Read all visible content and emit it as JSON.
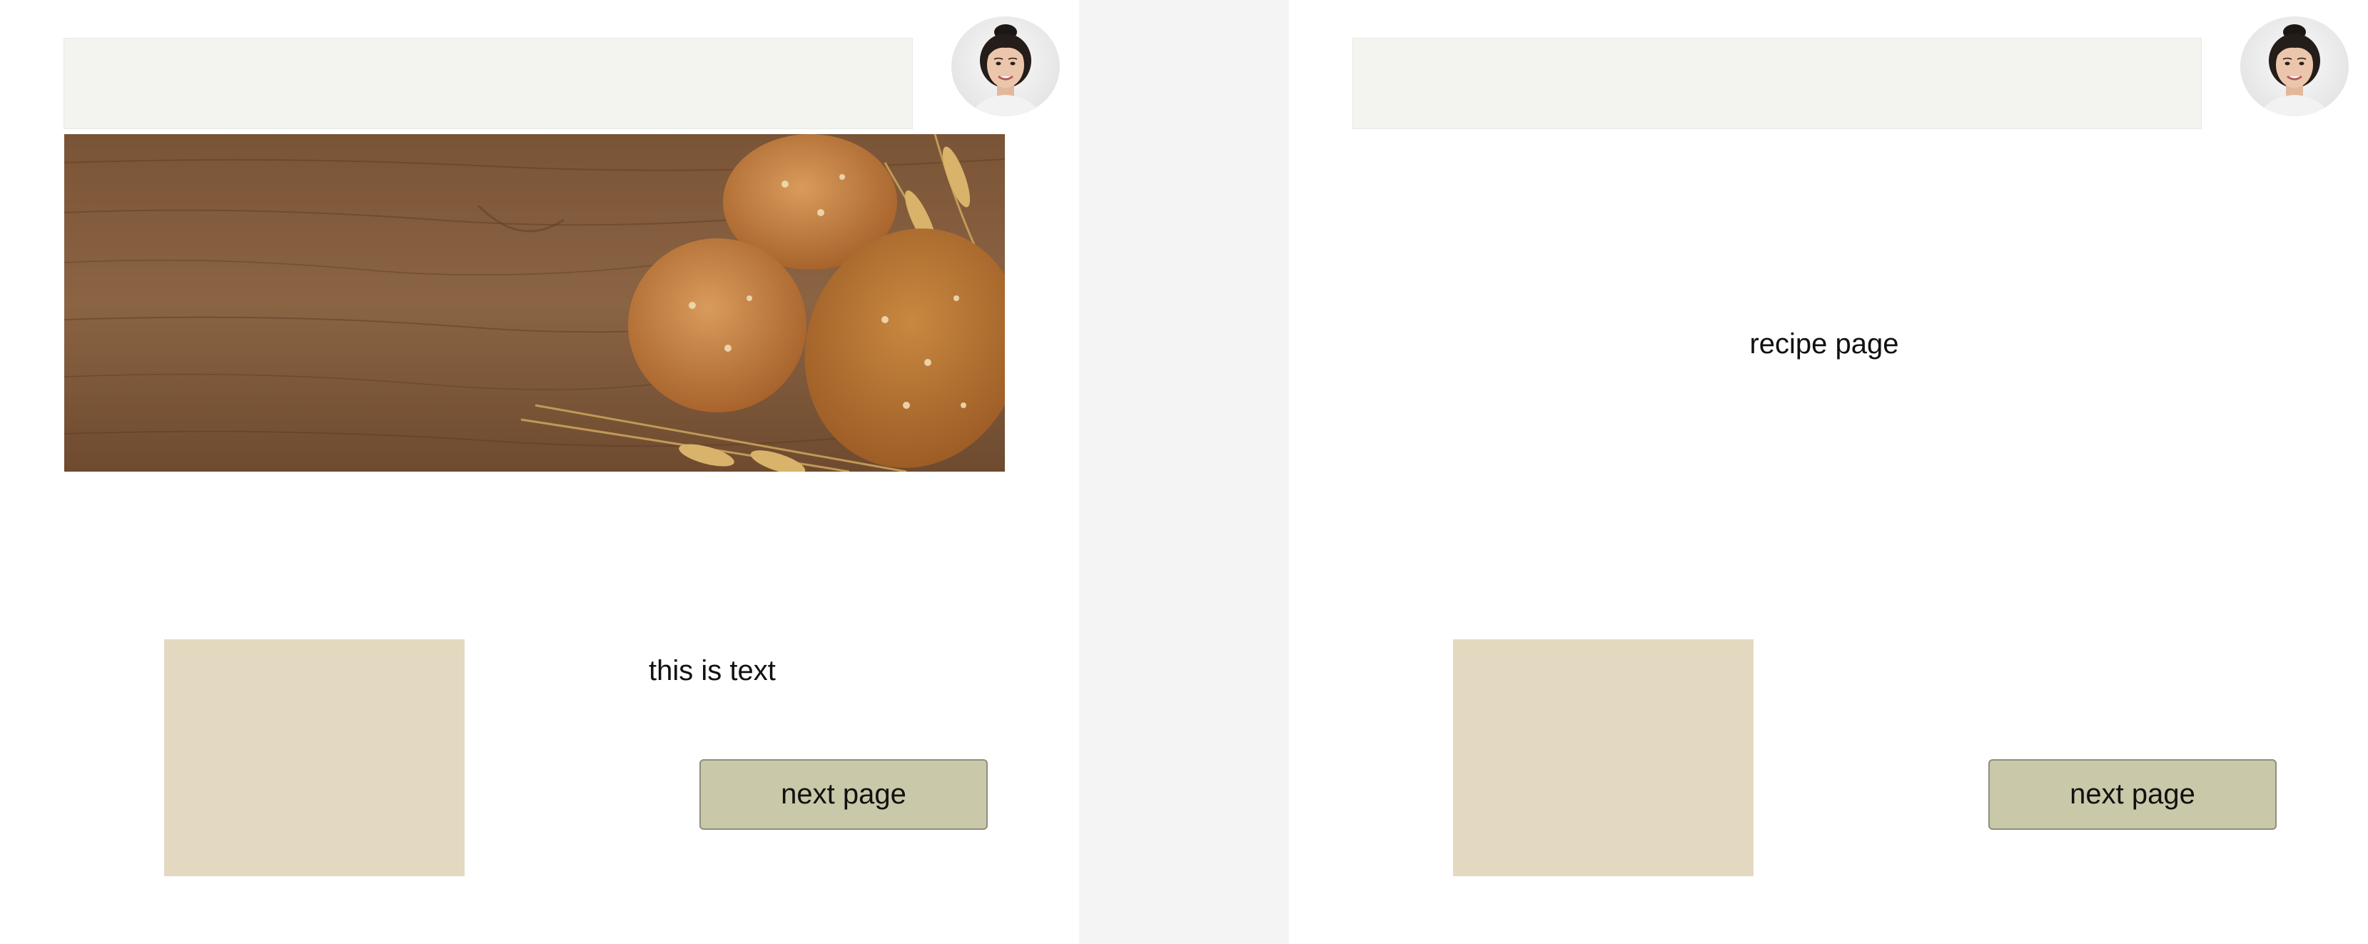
{
  "left_page": {
    "hero_image_alt": "",
    "body_text": "this is text",
    "next_button_label": "next page"
  },
  "right_page": {
    "title": "recipe page",
    "next_button_label": "next page"
  },
  "colors": {
    "canvas_background": "#f4f4f4",
    "frame_background": "#ffffff",
    "search_bar": "#f3f3ef",
    "placeholder_box": "#e3d9c0",
    "button_fill": "#c9c8a8",
    "button_border": "#8f8f80"
  },
  "icons": {
    "avatar": "avatar-icon"
  }
}
